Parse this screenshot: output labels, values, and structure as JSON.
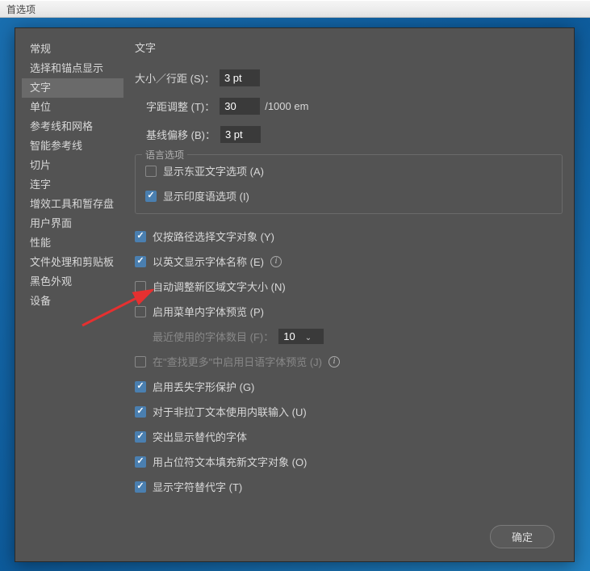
{
  "titlebar": "首选项",
  "sidebar": {
    "items": [
      {
        "label": "常规"
      },
      {
        "label": "选择和锚点显示"
      },
      {
        "label": "文字"
      },
      {
        "label": "单位"
      },
      {
        "label": "参考线和网格"
      },
      {
        "label": "智能参考线"
      },
      {
        "label": "切片"
      },
      {
        "label": "连字"
      },
      {
        "label": "增效工具和暂存盘"
      },
      {
        "label": "用户界面"
      },
      {
        "label": "性能"
      },
      {
        "label": "文件处理和剪贴板"
      },
      {
        "label": "黑色外观"
      },
      {
        "label": "设备"
      }
    ],
    "active_index": 2
  },
  "content": {
    "title": "文字",
    "size_leading": {
      "label": "大小／行距 (S)：",
      "value": "3 pt"
    },
    "tracking": {
      "label": "字距调整 (T)：",
      "value": "30",
      "unit": "/1000 em"
    },
    "baseline": {
      "label": "基线偏移 (B)：",
      "value": "3 pt"
    },
    "lang_section": {
      "title": "语言选项",
      "show_east_asian": {
        "label": "显示东亚文字选项 (A)",
        "checked": false
      },
      "show_indic": {
        "label": "显示印度语选项 (I)",
        "checked": true
      }
    },
    "opts": {
      "path_only": {
        "label": "仅按路径选择文字对象 (Y)",
        "checked": true
      },
      "english_font_names": {
        "label": "以英文显示字体名称 (E)",
        "checked": true
      },
      "auto_resize_area": {
        "label": "自动调整新区域文字大小 (N)",
        "checked": false
      },
      "menu_font_preview": {
        "label": "启用菜单内字体预览 (P)",
        "checked": false
      },
      "recent_fonts": {
        "label": "最近使用的字体数目 (F)：",
        "value": "10"
      },
      "jp_preview": {
        "label": "在\"查找更多\"中启用日语字体预览 (J)",
        "checked": false
      },
      "missing_glyph": {
        "label": "启用丢失字形保护 (G)",
        "checked": true
      },
      "inline_input": {
        "label": "对于非拉丁文本使用内联输入 (U)",
        "checked": true
      },
      "highlight_alt": {
        "label": "突出显示替代的字体",
        "checked": true
      },
      "placeholder_fill": {
        "label": "用占位符文本填充新文字对象 (O)",
        "checked": true
      },
      "show_alt_glyphs": {
        "label": "显示字符替代字 (T)",
        "checked": true
      }
    }
  },
  "buttons": {
    "ok": "确定"
  }
}
